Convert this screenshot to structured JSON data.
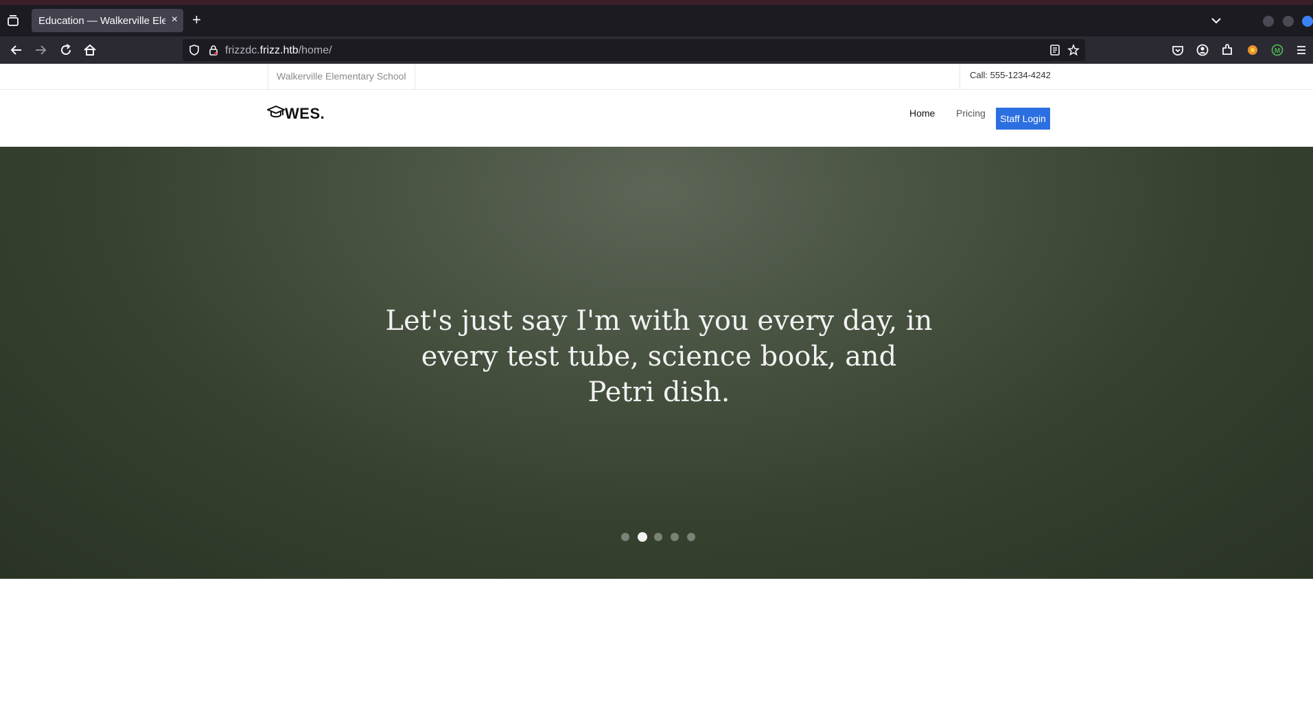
{
  "browser": {
    "tab_title": "Education — Walkerville Elementary School",
    "tab_close": "×",
    "new_tab": "+",
    "url_prefix": "frizzdc.",
    "url_host": "frizz.htb",
    "url_path": "/home/"
  },
  "site": {
    "school_name": "Walkerville Elementary School",
    "phone": "Call: 555-1234-4242",
    "logo": "WES.",
    "menu": {
      "home": "Home",
      "pricing": "Pricing",
      "staff_login": "Staff Login"
    },
    "hero": {
      "quote": "Let's just say I'm with you every day, in every test tube, science book, and Petri dish.",
      "slide_count": 5,
      "active_slide": 2
    }
  },
  "colors": {
    "accent": "#2c6fe0",
    "browser_dark": "#1c1b22",
    "toolbar": "#2b2a33"
  }
}
